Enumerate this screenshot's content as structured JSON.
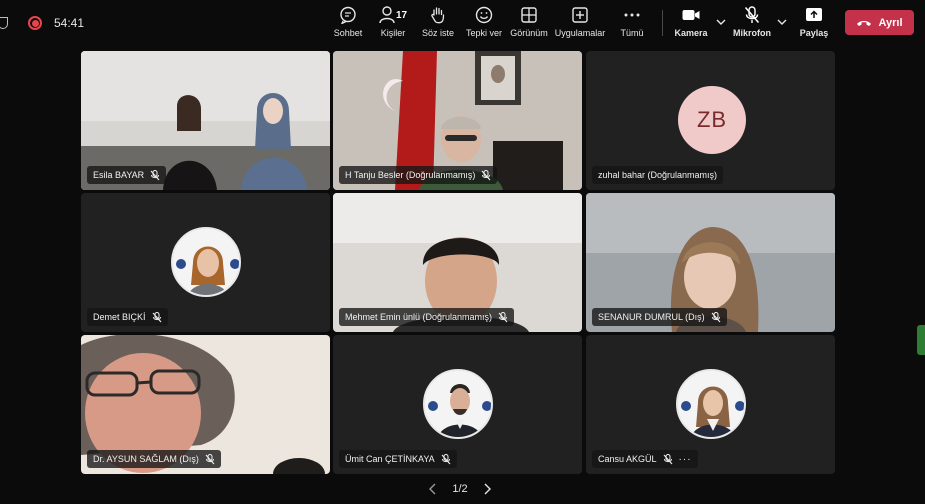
{
  "status": {
    "timer": "54:41"
  },
  "toolbar": {
    "chat": "Sohbet",
    "people": "Kişiler",
    "people_count": "17",
    "raise_hand": "Söz iste",
    "react": "Tepki ver",
    "view": "Görünüm",
    "apps": "Uygulamalar",
    "more": "Tümü",
    "camera": "Kamera",
    "mic": "Mikrofon",
    "share": "Paylaş",
    "leave": "Ayrıl"
  },
  "tiles": [
    {
      "name": "Esila BAYAR"
    },
    {
      "name": "H Tanju Besler (Doğrulanmamış)"
    },
    {
      "name": "zuhal bahar (Doğrulanmamış)",
      "initials": "ZB"
    },
    {
      "name": "Demet BIÇKİ"
    },
    {
      "name": "Mehmet Emin ünlü (Doğrulanmamış)"
    },
    {
      "name": "SENANUR DUMRUL (Dış)"
    },
    {
      "name": "Dr. AYSUN SAĞLAM (Dış)"
    },
    {
      "name": "Ümit Can ÇETİNKAYA"
    },
    {
      "name": "Cansu AKGÜL",
      "more": "···"
    }
  ],
  "pager": {
    "label": "1/2"
  },
  "colors": {
    "leave": "#c4314b",
    "recording": "#e7464d",
    "avatar_bg": "#f0c9c9"
  }
}
